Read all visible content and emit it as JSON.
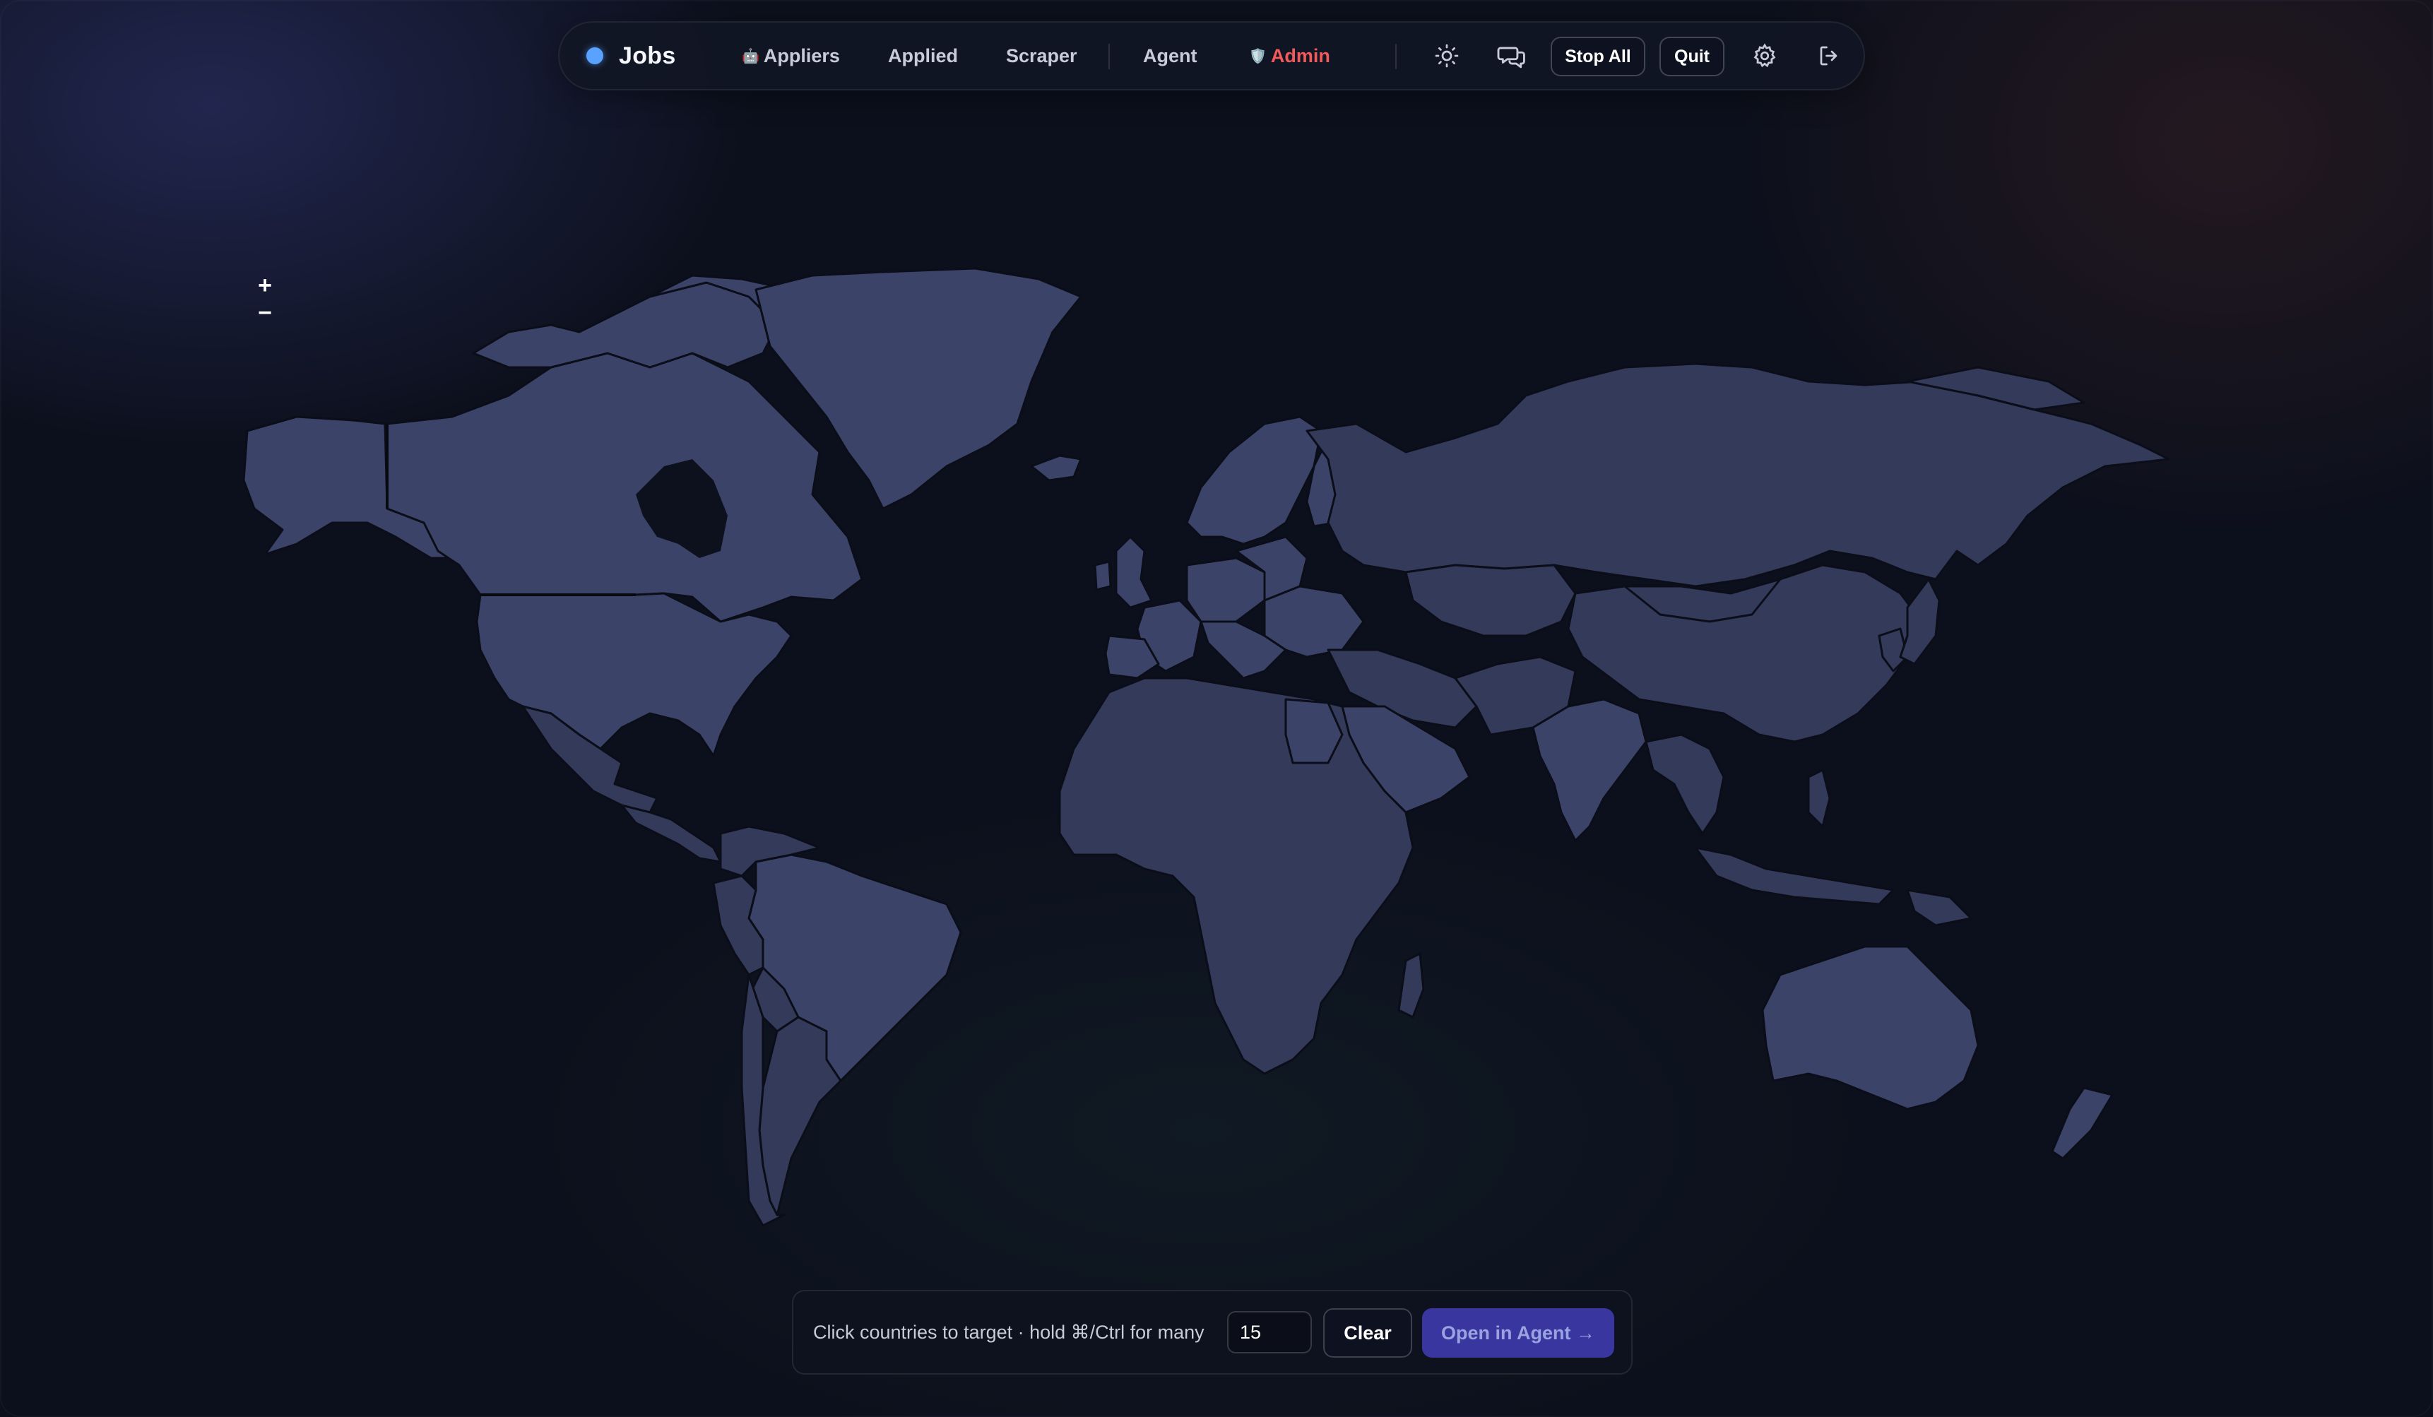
{
  "nav": {
    "brand": "Jobs",
    "links": [
      {
        "label": "Appliers",
        "emoji": "🤖"
      },
      {
        "label": "Applied",
        "emoji": ""
      },
      {
        "label": "Scraper",
        "emoji": ""
      },
      {
        "label": "Agent",
        "emoji": ""
      },
      {
        "label": "Admin",
        "emoji": "🛡️"
      }
    ],
    "stop_all": "Stop All",
    "quit": "Quit",
    "icons": [
      "sun-icon",
      "chat-icon",
      "gear-icon",
      "logout-icon"
    ]
  },
  "map": {
    "zoom_in": "+",
    "zoom_out": "−"
  },
  "bottom_bar": {
    "hint": "Click countries to target · hold ⌘/Ctrl for many",
    "count_value": "15",
    "clear": "Clear",
    "open_agent": "Open in Agent →"
  },
  "colors": {
    "background": "#0c101c",
    "land": "#2e3350",
    "land_highlight": "#3b4468",
    "brand_dot": "#5aa2ff",
    "admin": "#f15a5a",
    "primary_button": "#3a36a0"
  }
}
